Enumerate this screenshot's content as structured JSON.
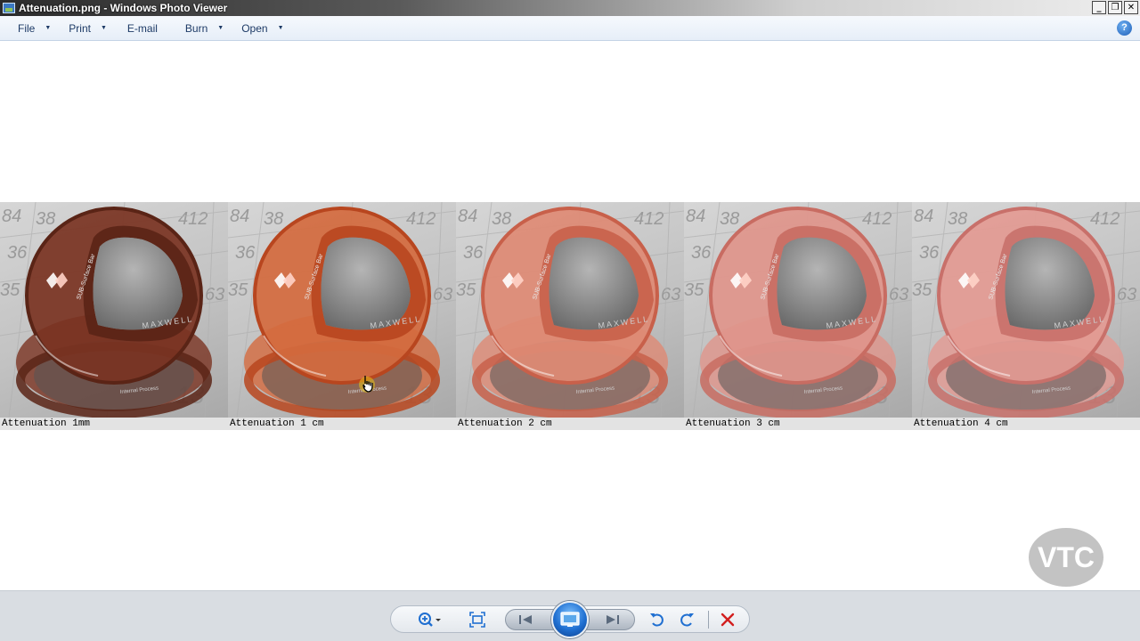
{
  "window": {
    "title": "Attenuation.png - Windows Photo Viewer",
    "controls": {
      "minimize": "_",
      "restore": "❐",
      "close": "✕"
    }
  },
  "menu": {
    "items": [
      {
        "label": "File",
        "has_dropdown": true
      },
      {
        "label": "Print",
        "has_dropdown": true
      },
      {
        "label": "E-mail",
        "has_dropdown": false
      },
      {
        "label": "Burn",
        "has_dropdown": true
      },
      {
        "label": "Open",
        "has_dropdown": true
      }
    ],
    "help": "?"
  },
  "image": {
    "panels": [
      {
        "caption": "Attenuation 1mm",
        "tint": "#5a2416",
        "glass": "#7a3322"
      },
      {
        "caption": "Attenuation 1 cm",
        "tint": "#b8461f",
        "glass": "#d46a3e"
      },
      {
        "caption": "Attenuation 2 cm",
        "tint": "#c8604a",
        "glass": "#de8a74"
      },
      {
        "caption": "Attenuation 3 cm",
        "tint": "#c86c62",
        "glass": "#e0958b"
      },
      {
        "caption": "Attenuation 4 cm",
        "tint": "#c8706a",
        "glass": "#e39a92"
      }
    ],
    "ball_label": "MAXWELL",
    "bar_label": "SUB-Surface Bar",
    "base_label": "Internal Process",
    "grid_numbers": [
      "84",
      "38",
      "412",
      "36",
      "35",
      "63",
      "13"
    ]
  },
  "watermark": {
    "text": "VTC"
  },
  "toolbar": {
    "buttons": [
      {
        "name": "zoom-button",
        "icon": "zoom-icon"
      },
      {
        "name": "actual-size-button",
        "icon": "fit-window-icon"
      },
      {
        "name": "previous-button",
        "icon": "previous-icon"
      },
      {
        "name": "slideshow-button",
        "icon": "slideshow-icon"
      },
      {
        "name": "next-button",
        "icon": "next-icon"
      },
      {
        "name": "rotate-counterclockwise-button",
        "icon": "rotate-left-icon"
      },
      {
        "name": "rotate-clockwise-button",
        "icon": "rotate-right-icon"
      },
      {
        "name": "delete-button",
        "icon": "delete-icon"
      }
    ],
    "accent": "#1f6fd1",
    "delete_color": "#d21f1f"
  }
}
